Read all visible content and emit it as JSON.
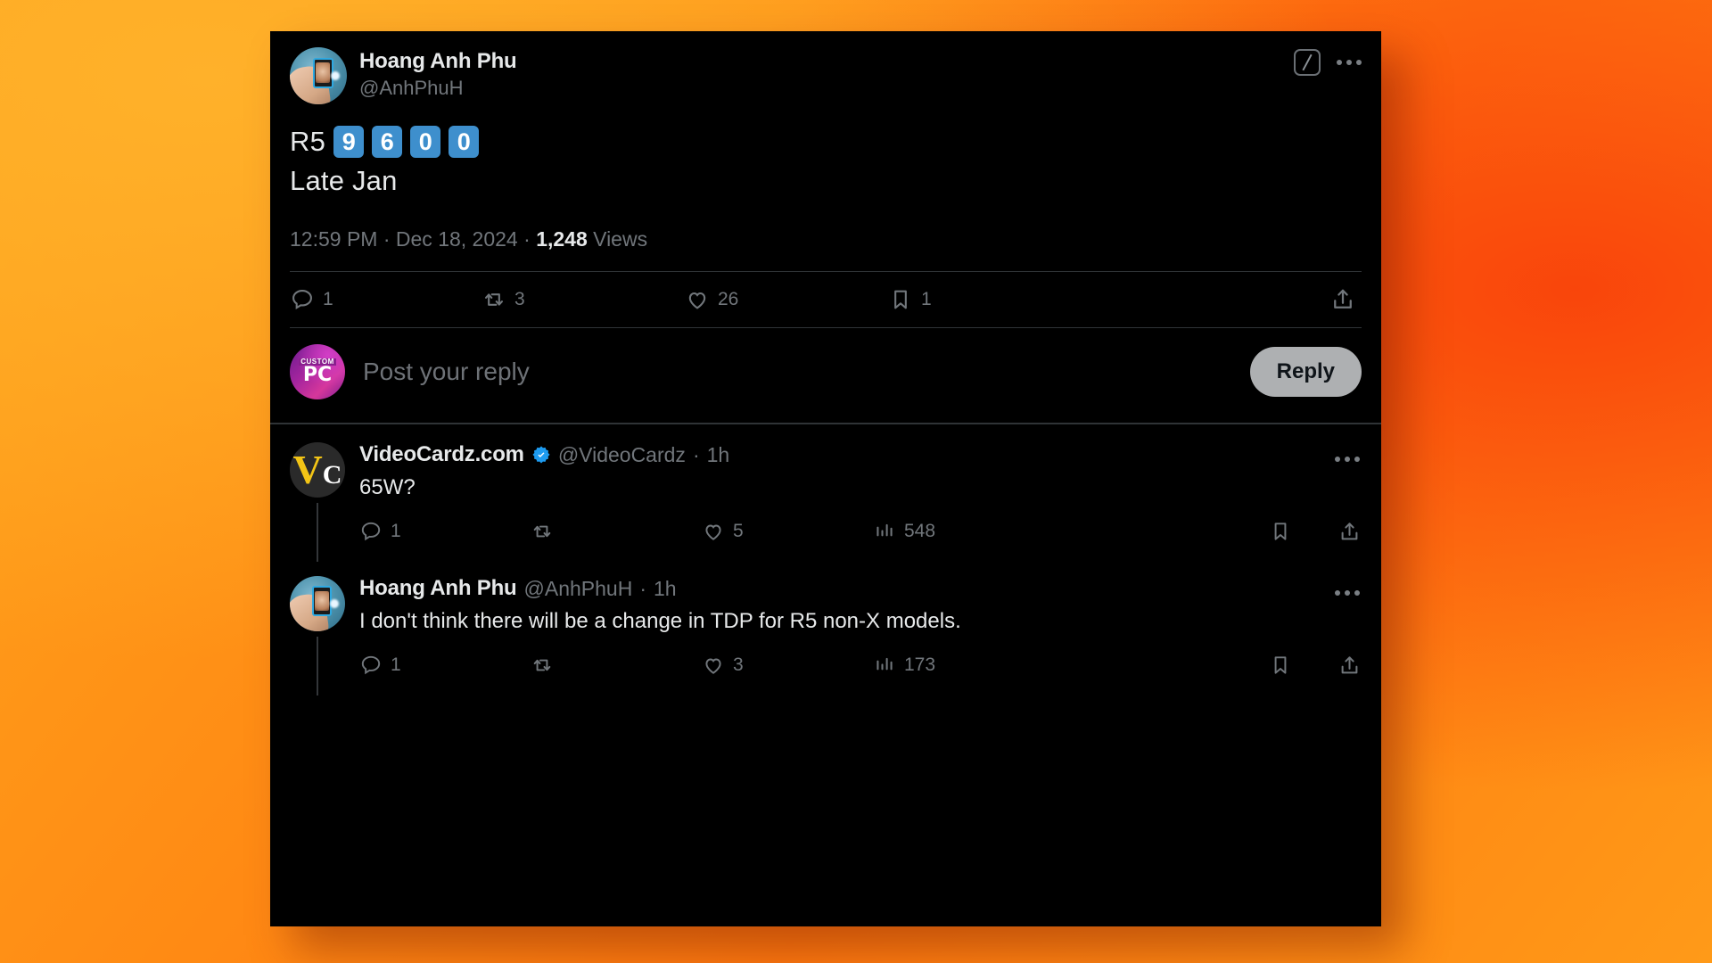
{
  "theme": {
    "card_bg": "#000000",
    "text_primary": "#E7E9EA",
    "text_muted": "#71767B",
    "divider": "#2F3336",
    "accent_blue": "#3E8FCD",
    "verified_blue": "#1D9BF0",
    "reply_button_bg": "#AEB0B2",
    "background_orange_light": "#FFA61C",
    "background_orange_deep": "#F9450B"
  },
  "main_tweet": {
    "author": {
      "display_name": "Hoang Anh Phu",
      "handle": "@AnhPhuH",
      "avatar_name": "avatar-hoang-anh-phu"
    },
    "header_actions": {
      "grok_icon": "grok-slash-icon",
      "more_icon": "more-options-icon"
    },
    "content": {
      "prefix": "R5",
      "digits": [
        "9",
        "6",
        "0",
        "0"
      ],
      "second_line": "Late Jan"
    },
    "meta": {
      "time": "12:59 PM",
      "sep1": "·",
      "date": "Dec 18, 2024",
      "sep2": "·",
      "views_count": "1,248",
      "views_label": "Views"
    },
    "actions": [
      {
        "name": "reply",
        "icon": "comment-icon",
        "count": "1"
      },
      {
        "name": "retweet",
        "icon": "retweet-icon",
        "count": "3"
      },
      {
        "name": "like",
        "icon": "heart-icon",
        "count": "26"
      },
      {
        "name": "bookmark",
        "icon": "bookmark-icon",
        "count": "1"
      },
      {
        "name": "share",
        "icon": "share-icon",
        "count": ""
      }
    ]
  },
  "composer": {
    "avatar_name": "avatar-custom-pc",
    "avatar_logo_top": "CUSTOM",
    "avatar_logo_bottom": "PC",
    "placeholder": "Post your reply",
    "reply_label": "Reply"
  },
  "replies": [
    {
      "author": {
        "display_name": "VideoCardz.com",
        "handle": "@VideoCardz",
        "verified": true,
        "avatar_name": "avatar-videocardz"
      },
      "timestamp_sep": "·",
      "timestamp": "1h",
      "text": "65W?",
      "more_icon": "more-options-icon",
      "actions": [
        {
          "name": "reply",
          "icon": "comment-icon",
          "count": "1"
        },
        {
          "name": "retweet",
          "icon": "retweet-icon",
          "count": ""
        },
        {
          "name": "like",
          "icon": "heart-icon",
          "count": "5"
        },
        {
          "name": "views",
          "icon": "views-bars-icon",
          "count": "548"
        },
        {
          "name": "bookmark",
          "icon": "bookmark-icon",
          "count": ""
        },
        {
          "name": "share",
          "icon": "share-icon",
          "count": ""
        }
      ]
    },
    {
      "author": {
        "display_name": "Hoang Anh Phu",
        "handle": "@AnhPhuH",
        "verified": false,
        "avatar_name": "avatar-hoang-anh-phu"
      },
      "timestamp_sep": "·",
      "timestamp": "1h",
      "text": "I don't think there will be a change in TDP for R5 non-X models.",
      "more_icon": "more-options-icon",
      "actions": [
        {
          "name": "reply",
          "icon": "comment-icon",
          "count": "1"
        },
        {
          "name": "retweet",
          "icon": "retweet-icon",
          "count": ""
        },
        {
          "name": "like",
          "icon": "heart-icon",
          "count": "3"
        },
        {
          "name": "views",
          "icon": "views-bars-icon",
          "count": "173"
        },
        {
          "name": "bookmark",
          "icon": "bookmark-icon",
          "count": ""
        },
        {
          "name": "share",
          "icon": "share-icon",
          "count": ""
        }
      ]
    }
  ]
}
